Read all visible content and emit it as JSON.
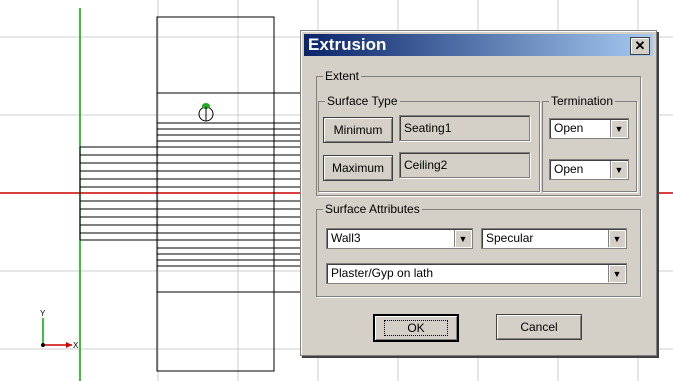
{
  "dialog": {
    "title": "Extrusion",
    "close_glyph": "✕",
    "extent": {
      "label": "Extent",
      "surface_type": {
        "label": "Surface Type",
        "minimum_button": "Minimum",
        "minimum_value": "Seating1",
        "maximum_button": "Maximum",
        "maximum_value": "Ceiling2"
      },
      "termination": {
        "label": "Termination",
        "min_value": "Open",
        "max_value": "Open"
      }
    },
    "surface_attributes": {
      "label": "Surface Attributes",
      "surface": "Wall3",
      "reflection": "Specular",
      "material": "Plaster/Gyp on lath"
    },
    "ok_label": "OK",
    "cancel_label": "Cancel"
  },
  "axis": {
    "y_label": "Y",
    "x_label": "X"
  },
  "colors": {
    "grid": "#cccccc",
    "x_axis": "#cc0000",
    "y_axis": "#00aa00",
    "geometry": "#000000",
    "title_start": "#0a246a",
    "title_end": "#a6caf0",
    "marker": "#22aa22"
  }
}
